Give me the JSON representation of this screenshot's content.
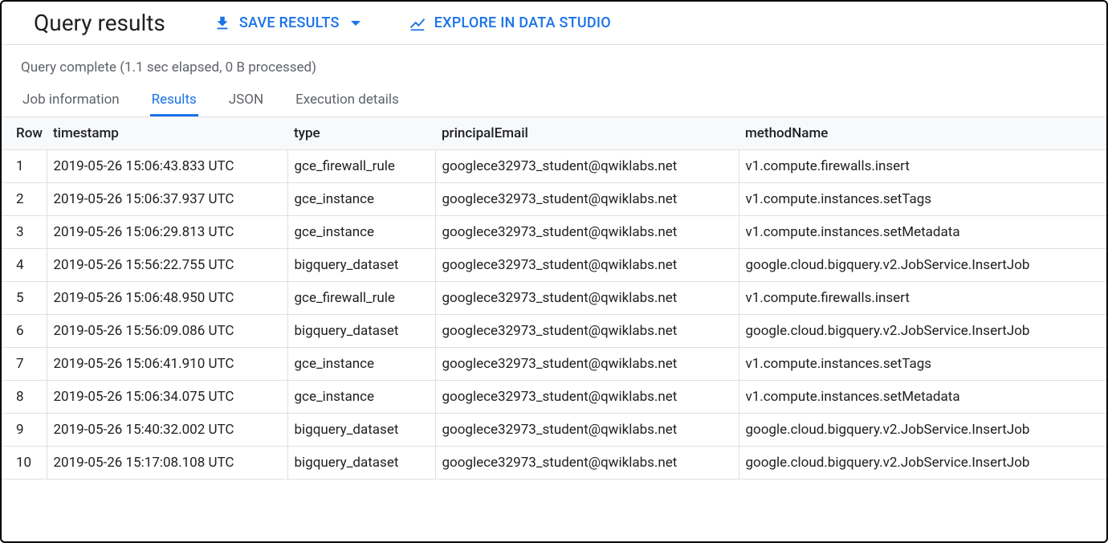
{
  "header": {
    "title": "Query results",
    "save_results_label": "SAVE RESULTS",
    "explore_label": "EXPLORE IN DATA STUDIO"
  },
  "status": "Query complete (1.1 sec elapsed, 0 B processed)",
  "tabs": [
    {
      "label": "Job information"
    },
    {
      "label": "Results"
    },
    {
      "label": "JSON"
    },
    {
      "label": "Execution details"
    }
  ],
  "active_tab_index": 1,
  "columns": {
    "row": "Row",
    "timestamp": "timestamp",
    "type": "type",
    "principalEmail": "principalEmail",
    "methodName": "methodName"
  },
  "rows": [
    {
      "row": "1",
      "timestamp": "2019-05-26 15:06:43.833 UTC",
      "type": "gce_firewall_rule",
      "principalEmail": "googlece32973_student@qwiklabs.net",
      "methodName": "v1.compute.firewalls.insert"
    },
    {
      "row": "2",
      "timestamp": "2019-05-26 15:06:37.937 UTC",
      "type": "gce_instance",
      "principalEmail": "googlece32973_student@qwiklabs.net",
      "methodName": "v1.compute.instances.setTags"
    },
    {
      "row": "3",
      "timestamp": "2019-05-26 15:06:29.813 UTC",
      "type": "gce_instance",
      "principalEmail": "googlece32973_student@qwiklabs.net",
      "methodName": "v1.compute.instances.setMetadata"
    },
    {
      "row": "4",
      "timestamp": "2019-05-26 15:56:22.755 UTC",
      "type": "bigquery_dataset",
      "principalEmail": "googlece32973_student@qwiklabs.net",
      "methodName": "google.cloud.bigquery.v2.JobService.InsertJob"
    },
    {
      "row": "5",
      "timestamp": "2019-05-26 15:06:48.950 UTC",
      "type": "gce_firewall_rule",
      "principalEmail": "googlece32973_student@qwiklabs.net",
      "methodName": "v1.compute.firewalls.insert"
    },
    {
      "row": "6",
      "timestamp": "2019-05-26 15:56:09.086 UTC",
      "type": "bigquery_dataset",
      "principalEmail": "googlece32973_student@qwiklabs.net",
      "methodName": "google.cloud.bigquery.v2.JobService.InsertJob"
    },
    {
      "row": "7",
      "timestamp": "2019-05-26 15:06:41.910 UTC",
      "type": "gce_instance",
      "principalEmail": "googlece32973_student@qwiklabs.net",
      "methodName": "v1.compute.instances.setTags"
    },
    {
      "row": "8",
      "timestamp": "2019-05-26 15:06:34.075 UTC",
      "type": "gce_instance",
      "principalEmail": "googlece32973_student@qwiklabs.net",
      "methodName": "v1.compute.instances.setMetadata"
    },
    {
      "row": "9",
      "timestamp": "2019-05-26 15:40:32.002 UTC",
      "type": "bigquery_dataset",
      "principalEmail": "googlece32973_student@qwiklabs.net",
      "methodName": "google.cloud.bigquery.v2.JobService.InsertJob"
    },
    {
      "row": "10",
      "timestamp": "2019-05-26 15:17:08.108 UTC",
      "type": "bigquery_dataset",
      "principalEmail": "googlece32973_student@qwiklabs.net",
      "methodName": "google.cloud.bigquery.v2.JobService.InsertJob"
    }
  ]
}
